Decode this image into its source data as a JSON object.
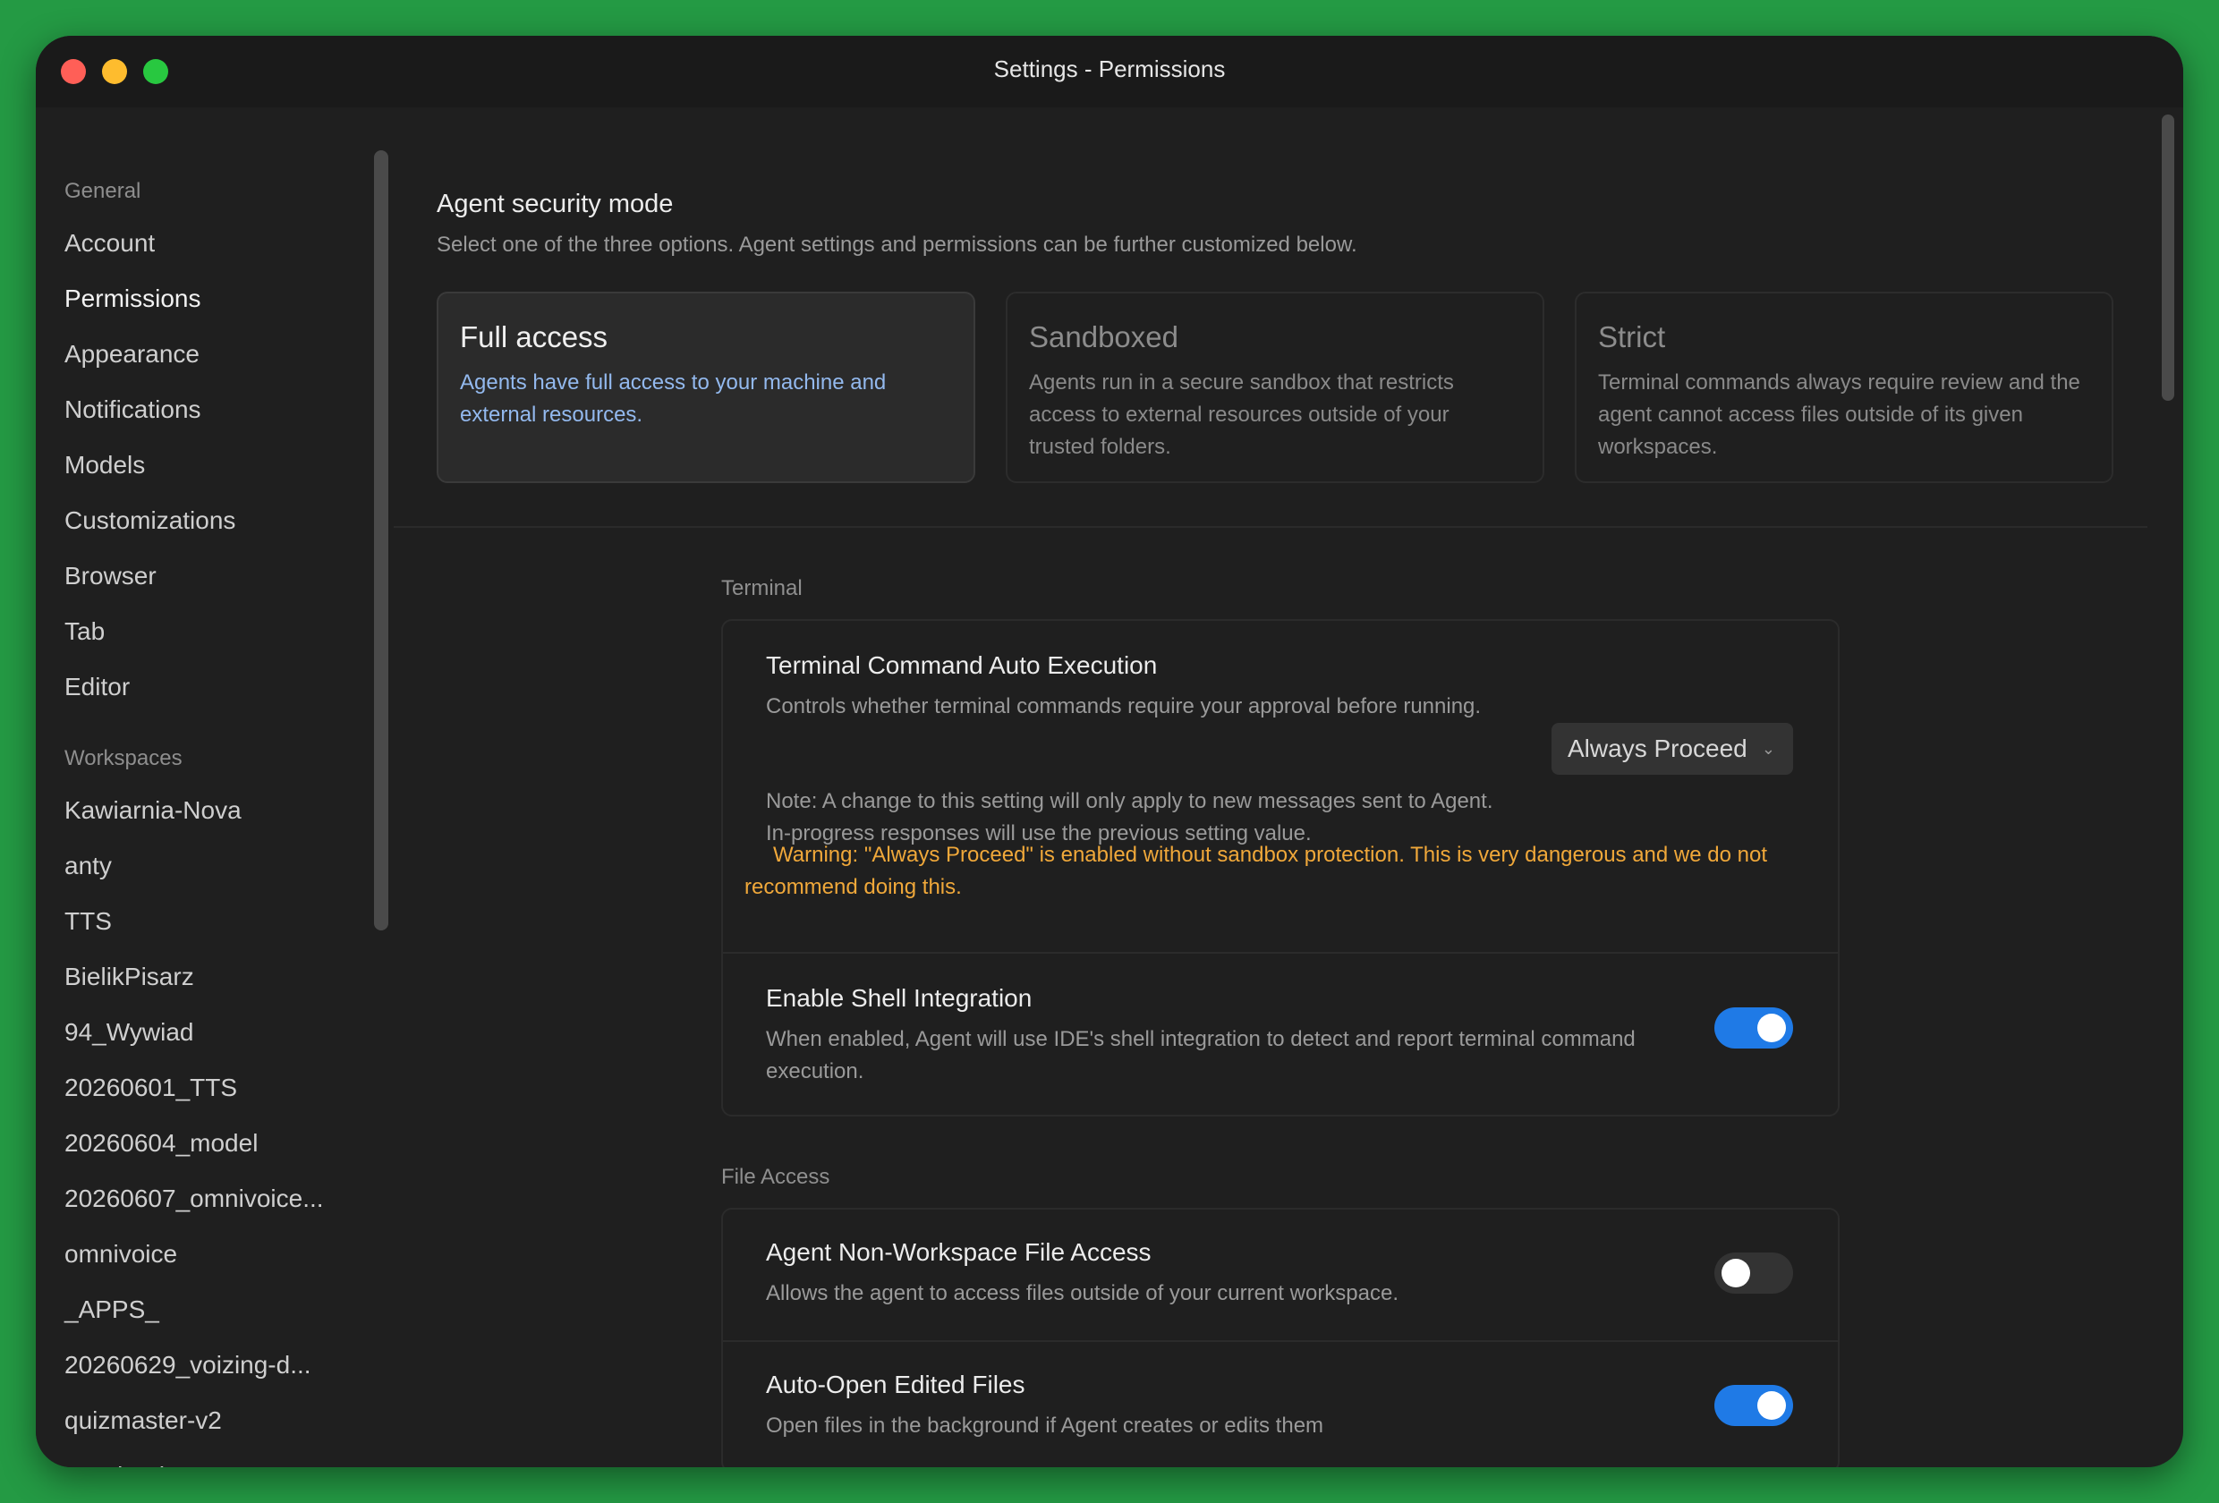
{
  "window": {
    "title": "Settings - Permissions"
  },
  "sidebar": {
    "general_header": "General",
    "general_items": [
      {
        "label": "Account"
      },
      {
        "label": "Permissions",
        "active": true
      },
      {
        "label": "Appearance"
      },
      {
        "label": "Notifications"
      },
      {
        "label": "Models"
      },
      {
        "label": "Customizations"
      },
      {
        "label": "Browser"
      },
      {
        "label": "Tab"
      },
      {
        "label": "Editor"
      }
    ],
    "workspaces_header": "Workspaces",
    "workspace_items": [
      {
        "label": "Kawiarnia-Nova"
      },
      {
        "label": "anty"
      },
      {
        "label": "TTS"
      },
      {
        "label": "BielikPisarz"
      },
      {
        "label": "94_Wywiad"
      },
      {
        "label": "20260601_TTS"
      },
      {
        "label": "20260604_model"
      },
      {
        "label": "20260607_omnivoice..."
      },
      {
        "label": "omnivoice"
      },
      {
        "label": "_APPS_"
      },
      {
        "label": "20260629_voizing-d..."
      },
      {
        "label": "quizmaster-v2"
      },
      {
        "label": "seoclaude"
      }
    ]
  },
  "main": {
    "security": {
      "title": "Agent security mode",
      "subtitle": "Select one of the three options. Agent settings and permissions can be further customized below.",
      "modes": [
        {
          "title": "Full access",
          "desc": "Agents have full access to your machine and external resources.",
          "selected": true
        },
        {
          "title": "Sandboxed",
          "desc": "Agents run in a secure sandbox that restricts access to external resources outside of your trusted folders.",
          "selected": false
        },
        {
          "title": "Strict",
          "desc": "Terminal commands always require review and the agent cannot access files outside of its given workspaces.",
          "selected": false
        }
      ]
    },
    "terminal": {
      "label": "Terminal",
      "auto_exec": {
        "title": "Terminal Command Auto Execution",
        "desc": "Controls whether terminal commands require your approval before running.",
        "note": "Note: A change to this setting will only apply to new messages sent to Agent. In-progress responses will use the previous setting value.",
        "dropdown_value": "Always Proceed",
        "warning": "Warning: \"Always Proceed\" is enabled without sandbox protection. This is very dangerous and we do not recommend doing this."
      },
      "shell": {
        "title": "Enable Shell Integration",
        "desc": "When enabled, Agent will use IDE's shell integration to detect and report terminal command execution.",
        "enabled": true
      }
    },
    "file_access": {
      "label": "File Access",
      "non_workspace": {
        "title": "Agent Non-Workspace File Access",
        "desc": "Allows the agent to access files outside of your current workspace.",
        "enabled": false
      },
      "auto_open": {
        "title": "Auto-Open Edited Files",
        "desc": "Open files in the background if Agent creates or edits them",
        "enabled": true
      }
    },
    "colors": {
      "accent": "#1f7ae6",
      "warning": "#f0a83a",
      "selected_desc": "#93b9ee"
    }
  }
}
